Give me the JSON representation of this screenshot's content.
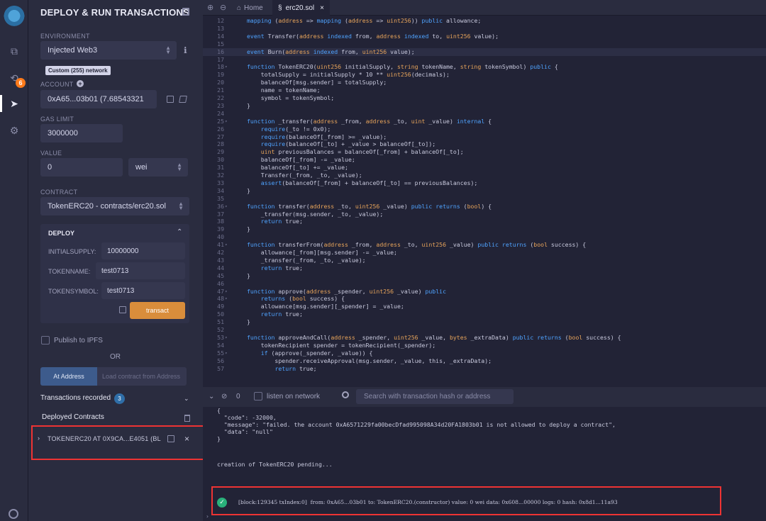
{
  "panel": {
    "title": "DEPLOY & RUN TRANSACTIONS",
    "environment_label": "ENVIRONMENT",
    "environment_value": "Injected Web3",
    "network_tag": "Custom (255) network",
    "account_label": "ACCOUNT",
    "account_value": "0xA65...03b01 (7.68543321",
    "gas_limit_label": "GAS LIMIT",
    "gas_limit_value": "3000000",
    "value_label": "VALUE",
    "value_amount": "0",
    "value_unit": "wei",
    "contract_label": "CONTRACT",
    "contract_value": "TokenERC20 - contracts/erc20.sol",
    "deploy": {
      "title": "DEPLOY",
      "initial_supply_label": "INITIALSUPPLY:",
      "initial_supply_value": "10000000",
      "token_name_label": "TOKENNAME:",
      "token_name_value": "test0713",
      "token_symbol_label": "TOKENSYMBOL:",
      "token_symbol_value": "test0713",
      "transact_label": "transact"
    },
    "publish_label": "Publish to IPFS",
    "or_label": "OR",
    "at_address_label": "At Address",
    "load_address_placeholder": "Load contract from Address",
    "transactions_recorded_label": "Transactions recorded",
    "transactions_recorded_count": "3",
    "deployed_contracts_label": "Deployed Contracts",
    "deployed_item": "TOKENERC20 AT 0X9CA...E4051 (BL"
  },
  "rail": {
    "badge": "6"
  },
  "tabs": {
    "home": "Home",
    "file": "erc20.sol"
  },
  "code_lines": [
    {
      "n": "12",
      "fold": "",
      "code": "mapping (address => mapping (address => uint256)) public allowance;"
    },
    {
      "n": "13",
      "fold": "",
      "code": ""
    },
    {
      "n": "14",
      "fold": "",
      "code": "event Transfer(address indexed from, address indexed to, uint256 value);"
    },
    {
      "n": "15",
      "fold": "",
      "code": ""
    },
    {
      "n": "16",
      "fold": "",
      "code": "event Burn(address indexed from, uint256 value);",
      "hl": true
    },
    {
      "n": "17",
      "fold": "",
      "code": ""
    },
    {
      "n": "18",
      "fold": "▾",
      "code": "function TokenERC20(uint256 initialSupply, string tokenName, string tokenSymbol) public {"
    },
    {
      "n": "19",
      "fold": "",
      "code": "    totalSupply = initialSupply * 10 ** uint256(decimals);"
    },
    {
      "n": "20",
      "fold": "",
      "code": "    balanceOf[msg.sender] = totalSupply;"
    },
    {
      "n": "21",
      "fold": "",
      "code": "    name = tokenName;"
    },
    {
      "n": "22",
      "fold": "",
      "code": "    symbol = tokenSymbol;"
    },
    {
      "n": "23",
      "fold": "",
      "code": "}"
    },
    {
      "n": "24",
      "fold": "",
      "code": ""
    },
    {
      "n": "25",
      "fold": "▾",
      "code": "function _transfer(address _from, address _to, uint _value) internal {"
    },
    {
      "n": "26",
      "fold": "",
      "code": "    require(_to != 0x0);"
    },
    {
      "n": "27",
      "fold": "",
      "code": "    require(balanceOf[_from] >= _value);"
    },
    {
      "n": "28",
      "fold": "",
      "code": "    require(balanceOf[_to] + _value > balanceOf[_to]);"
    },
    {
      "n": "29",
      "fold": "",
      "code": "    uint previousBalances = balanceOf[_from] + balanceOf[_to];"
    },
    {
      "n": "30",
      "fold": "",
      "code": "    balanceOf[_from] -= _value;"
    },
    {
      "n": "31",
      "fold": "",
      "code": "    balanceOf[_to] += _value;"
    },
    {
      "n": "32",
      "fold": "",
      "code": "    Transfer(_from, _to, _value);"
    },
    {
      "n": "33",
      "fold": "",
      "code": "    assert(balanceOf[_from] + balanceOf[_to] == previousBalances);"
    },
    {
      "n": "34",
      "fold": "",
      "code": "}"
    },
    {
      "n": "35",
      "fold": "",
      "code": ""
    },
    {
      "n": "36",
      "fold": "▾",
      "code": "function transfer(address _to, uint256 _value) public returns (bool) {"
    },
    {
      "n": "37",
      "fold": "",
      "code": "    _transfer(msg.sender, _to, _value);"
    },
    {
      "n": "38",
      "fold": "",
      "code": "    return true;"
    },
    {
      "n": "39",
      "fold": "",
      "code": "}"
    },
    {
      "n": "40",
      "fold": "",
      "code": ""
    },
    {
      "n": "41",
      "fold": "▾",
      "code": "function transferFrom(address _from, address _to, uint256 _value) public returns (bool success) {"
    },
    {
      "n": "42",
      "fold": "",
      "code": "    allowance[_from][msg.sender] -= _value;"
    },
    {
      "n": "43",
      "fold": "",
      "code": "    _transfer(_from, _to, _value);"
    },
    {
      "n": "44",
      "fold": "",
      "code": "    return true;"
    },
    {
      "n": "45",
      "fold": "",
      "code": "}"
    },
    {
      "n": "46",
      "fold": "",
      "code": ""
    },
    {
      "n": "47",
      "fold": "▾",
      "code": "function approve(address _spender, uint256 _value) public"
    },
    {
      "n": "48",
      "fold": "▾",
      "code": "    returns (bool success) {"
    },
    {
      "n": "49",
      "fold": "",
      "code": "    allowance[msg.sender][_spender] = _value;"
    },
    {
      "n": "50",
      "fold": "",
      "code": "    return true;"
    },
    {
      "n": "51",
      "fold": "",
      "code": "}"
    },
    {
      "n": "52",
      "fold": "",
      "code": ""
    },
    {
      "n": "53",
      "fold": "▾",
      "code": "function approveAndCall(address _spender, uint256 _value, bytes _extraData) public returns (bool success) {"
    },
    {
      "n": "54",
      "fold": "",
      "code": "    tokenRecipient spender = tokenRecipient(_spender);"
    },
    {
      "n": "55",
      "fold": "▾",
      "code": "    if (approve(_spender, _value)) {"
    },
    {
      "n": "56",
      "fold": "",
      "code": "        spender.receiveApproval(msg.sender, _value, this, _extraData);"
    },
    {
      "n": "57",
      "fold": "",
      "code": "        return true;"
    }
  ],
  "terminal": {
    "listen_label": "listen on network",
    "pending_count": "0",
    "search_placeholder": "Search with transaction hash or address",
    "error_lines": [
      "{",
      "  \"code\": -32000,",
      "  \"message\": \"failed. the account 0xA6571229fa00becDfad995098A34d20FA1803b01 is not allowed to deploy a contract\",",
      "  \"data\": \"null\"",
      "}"
    ],
    "pending_line": "creation of TokenERC20 pending...",
    "tx_line": "[block:129345 txIndex:0]  from: 0xA65...03b01 to: TokenERC20.(constructor) value: 0 wei data: 0x608...00000 logs: 0 hash: 0x8d1...11a93"
  }
}
